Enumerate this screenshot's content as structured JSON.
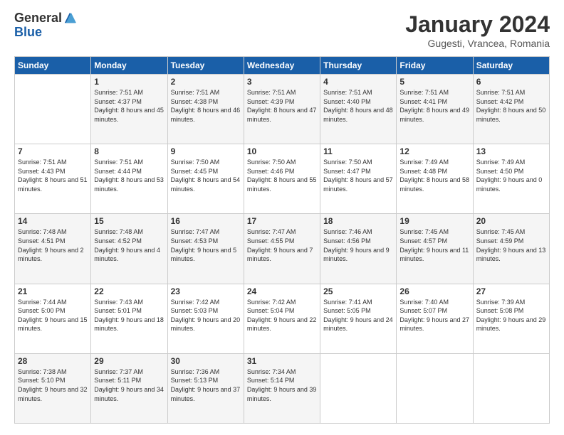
{
  "header": {
    "logo_general": "General",
    "logo_blue": "Blue",
    "title": "January 2024",
    "location": "Gugesti, Vrancea, Romania"
  },
  "weekdays": [
    "Sunday",
    "Monday",
    "Tuesday",
    "Wednesday",
    "Thursday",
    "Friday",
    "Saturday"
  ],
  "weeks": [
    [
      {
        "day": "",
        "sunrise": "",
        "sunset": "",
        "daylight": ""
      },
      {
        "day": "1",
        "sunrise": "Sunrise: 7:51 AM",
        "sunset": "Sunset: 4:37 PM",
        "daylight": "Daylight: 8 hours and 45 minutes."
      },
      {
        "day": "2",
        "sunrise": "Sunrise: 7:51 AM",
        "sunset": "Sunset: 4:38 PM",
        "daylight": "Daylight: 8 hours and 46 minutes."
      },
      {
        "day": "3",
        "sunrise": "Sunrise: 7:51 AM",
        "sunset": "Sunset: 4:39 PM",
        "daylight": "Daylight: 8 hours and 47 minutes."
      },
      {
        "day": "4",
        "sunrise": "Sunrise: 7:51 AM",
        "sunset": "Sunset: 4:40 PM",
        "daylight": "Daylight: 8 hours and 48 minutes."
      },
      {
        "day": "5",
        "sunrise": "Sunrise: 7:51 AM",
        "sunset": "Sunset: 4:41 PM",
        "daylight": "Daylight: 8 hours and 49 minutes."
      },
      {
        "day": "6",
        "sunrise": "Sunrise: 7:51 AM",
        "sunset": "Sunset: 4:42 PM",
        "daylight": "Daylight: 8 hours and 50 minutes."
      }
    ],
    [
      {
        "day": "7",
        "sunrise": "Sunrise: 7:51 AM",
        "sunset": "Sunset: 4:43 PM",
        "daylight": "Daylight: 8 hours and 51 minutes."
      },
      {
        "day": "8",
        "sunrise": "Sunrise: 7:51 AM",
        "sunset": "Sunset: 4:44 PM",
        "daylight": "Daylight: 8 hours and 53 minutes."
      },
      {
        "day": "9",
        "sunrise": "Sunrise: 7:50 AM",
        "sunset": "Sunset: 4:45 PM",
        "daylight": "Daylight: 8 hours and 54 minutes."
      },
      {
        "day": "10",
        "sunrise": "Sunrise: 7:50 AM",
        "sunset": "Sunset: 4:46 PM",
        "daylight": "Daylight: 8 hours and 55 minutes."
      },
      {
        "day": "11",
        "sunrise": "Sunrise: 7:50 AM",
        "sunset": "Sunset: 4:47 PM",
        "daylight": "Daylight: 8 hours and 57 minutes."
      },
      {
        "day": "12",
        "sunrise": "Sunrise: 7:49 AM",
        "sunset": "Sunset: 4:48 PM",
        "daylight": "Daylight: 8 hours and 58 minutes."
      },
      {
        "day": "13",
        "sunrise": "Sunrise: 7:49 AM",
        "sunset": "Sunset: 4:50 PM",
        "daylight": "Daylight: 9 hours and 0 minutes."
      }
    ],
    [
      {
        "day": "14",
        "sunrise": "Sunrise: 7:48 AM",
        "sunset": "Sunset: 4:51 PM",
        "daylight": "Daylight: 9 hours and 2 minutes."
      },
      {
        "day": "15",
        "sunrise": "Sunrise: 7:48 AM",
        "sunset": "Sunset: 4:52 PM",
        "daylight": "Daylight: 9 hours and 4 minutes."
      },
      {
        "day": "16",
        "sunrise": "Sunrise: 7:47 AM",
        "sunset": "Sunset: 4:53 PM",
        "daylight": "Daylight: 9 hours and 5 minutes."
      },
      {
        "day": "17",
        "sunrise": "Sunrise: 7:47 AM",
        "sunset": "Sunset: 4:55 PM",
        "daylight": "Daylight: 9 hours and 7 minutes."
      },
      {
        "day": "18",
        "sunrise": "Sunrise: 7:46 AM",
        "sunset": "Sunset: 4:56 PM",
        "daylight": "Daylight: 9 hours and 9 minutes."
      },
      {
        "day": "19",
        "sunrise": "Sunrise: 7:45 AM",
        "sunset": "Sunset: 4:57 PM",
        "daylight": "Daylight: 9 hours and 11 minutes."
      },
      {
        "day": "20",
        "sunrise": "Sunrise: 7:45 AM",
        "sunset": "Sunset: 4:59 PM",
        "daylight": "Daylight: 9 hours and 13 minutes."
      }
    ],
    [
      {
        "day": "21",
        "sunrise": "Sunrise: 7:44 AM",
        "sunset": "Sunset: 5:00 PM",
        "daylight": "Daylight: 9 hours and 15 minutes."
      },
      {
        "day": "22",
        "sunrise": "Sunrise: 7:43 AM",
        "sunset": "Sunset: 5:01 PM",
        "daylight": "Daylight: 9 hours and 18 minutes."
      },
      {
        "day": "23",
        "sunrise": "Sunrise: 7:42 AM",
        "sunset": "Sunset: 5:03 PM",
        "daylight": "Daylight: 9 hours and 20 minutes."
      },
      {
        "day": "24",
        "sunrise": "Sunrise: 7:42 AM",
        "sunset": "Sunset: 5:04 PM",
        "daylight": "Daylight: 9 hours and 22 minutes."
      },
      {
        "day": "25",
        "sunrise": "Sunrise: 7:41 AM",
        "sunset": "Sunset: 5:05 PM",
        "daylight": "Daylight: 9 hours and 24 minutes."
      },
      {
        "day": "26",
        "sunrise": "Sunrise: 7:40 AM",
        "sunset": "Sunset: 5:07 PM",
        "daylight": "Daylight: 9 hours and 27 minutes."
      },
      {
        "day": "27",
        "sunrise": "Sunrise: 7:39 AM",
        "sunset": "Sunset: 5:08 PM",
        "daylight": "Daylight: 9 hours and 29 minutes."
      }
    ],
    [
      {
        "day": "28",
        "sunrise": "Sunrise: 7:38 AM",
        "sunset": "Sunset: 5:10 PM",
        "daylight": "Daylight: 9 hours and 32 minutes."
      },
      {
        "day": "29",
        "sunrise": "Sunrise: 7:37 AM",
        "sunset": "Sunset: 5:11 PM",
        "daylight": "Daylight: 9 hours and 34 minutes."
      },
      {
        "day": "30",
        "sunrise": "Sunrise: 7:36 AM",
        "sunset": "Sunset: 5:13 PM",
        "daylight": "Daylight: 9 hours and 37 minutes."
      },
      {
        "day": "31",
        "sunrise": "Sunrise: 7:34 AM",
        "sunset": "Sunset: 5:14 PM",
        "daylight": "Daylight: 9 hours and 39 minutes."
      },
      {
        "day": "",
        "sunrise": "",
        "sunset": "",
        "daylight": ""
      },
      {
        "day": "",
        "sunrise": "",
        "sunset": "",
        "daylight": ""
      },
      {
        "day": "",
        "sunrise": "",
        "sunset": "",
        "daylight": ""
      }
    ]
  ]
}
